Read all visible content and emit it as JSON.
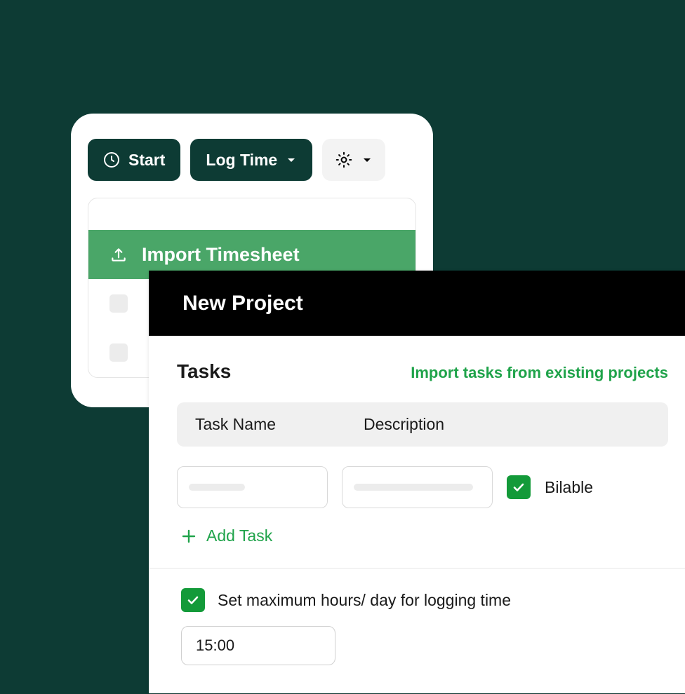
{
  "toolbar": {
    "start_label": "Start",
    "log_time_label": "Log Time"
  },
  "list": {
    "import_label": "Import Timesheet"
  },
  "project": {
    "title": "New Project",
    "tasks_title": "Tasks",
    "import_link": "Import tasks from existing projects",
    "columns": {
      "name": "Task Name",
      "description": "Description"
    },
    "billable_label": "Bilable",
    "billable_checked": true,
    "add_task_label": "Add Task",
    "max_hours_label": "Set maximum hours/ day for logging time",
    "max_hours_checked": true,
    "max_hours_value": "15:00"
  },
  "colors": {
    "brand_green": "#139a39",
    "dark_teal": "#0d3b34",
    "mid_green": "#4aa668"
  }
}
